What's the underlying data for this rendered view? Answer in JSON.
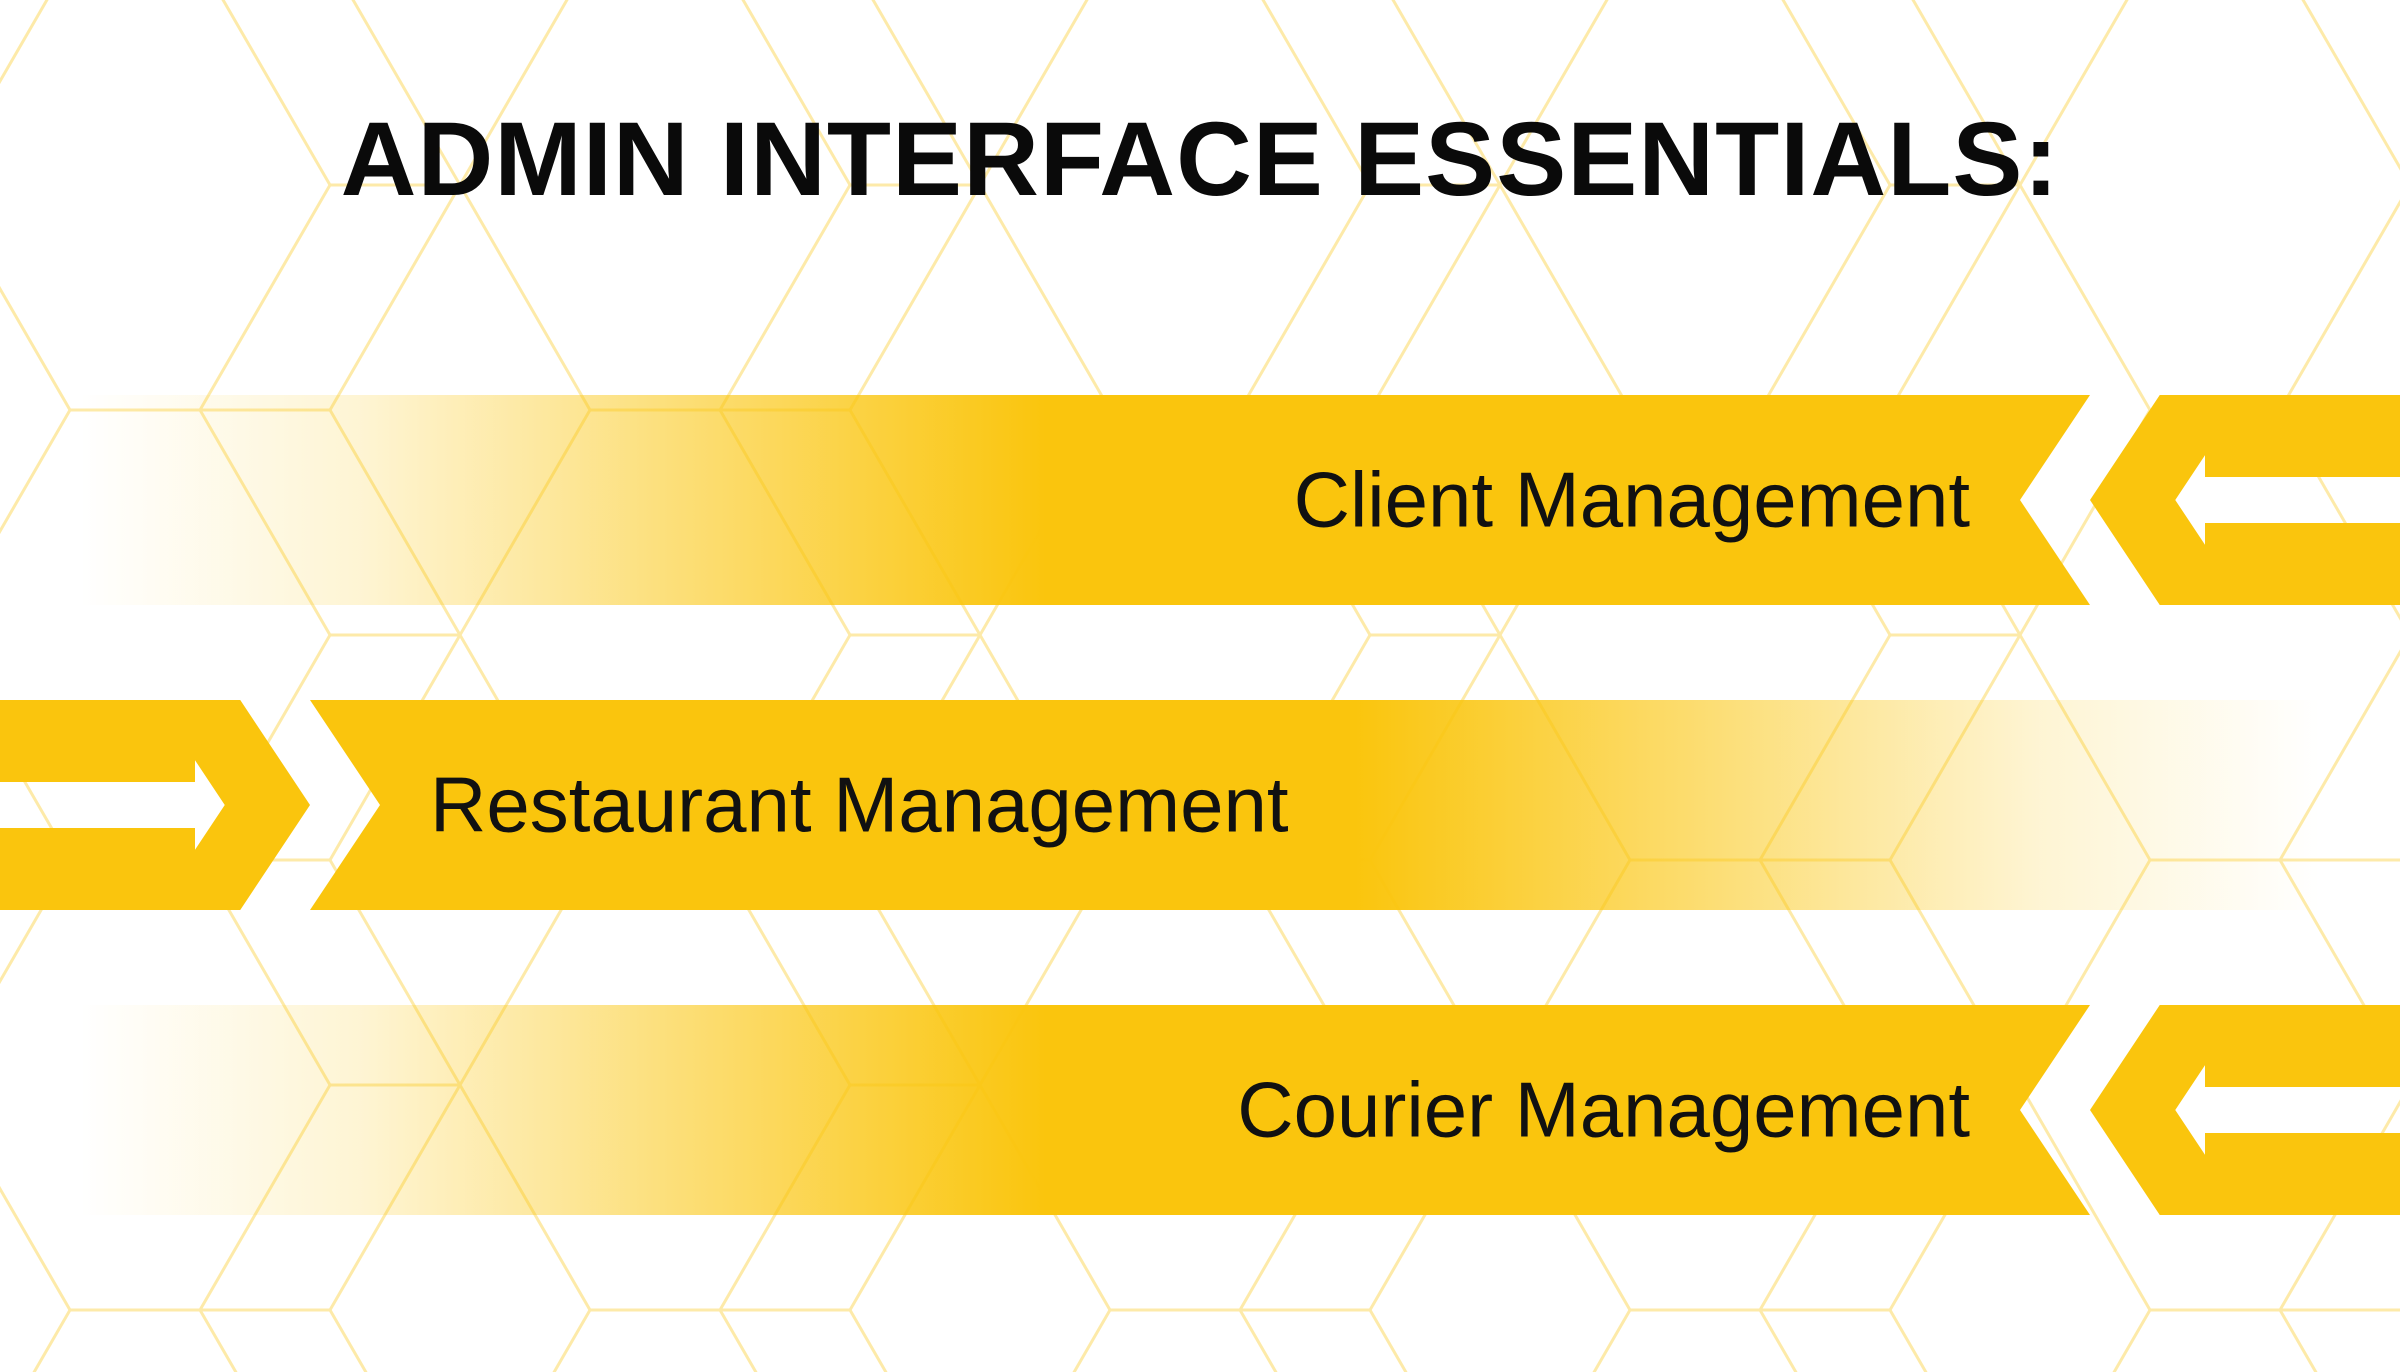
{
  "title": "ADMIN INTERFACE ESSENTIALS:",
  "items": [
    {
      "label": "Client Management",
      "direction": "right"
    },
    {
      "label": "Restaurant Management",
      "direction": "left"
    },
    {
      "label": "Courier Management",
      "direction": "right"
    }
  ],
  "colors": {
    "accent": "#fac50d",
    "text": "#111111",
    "bg": "#ffffff"
  }
}
